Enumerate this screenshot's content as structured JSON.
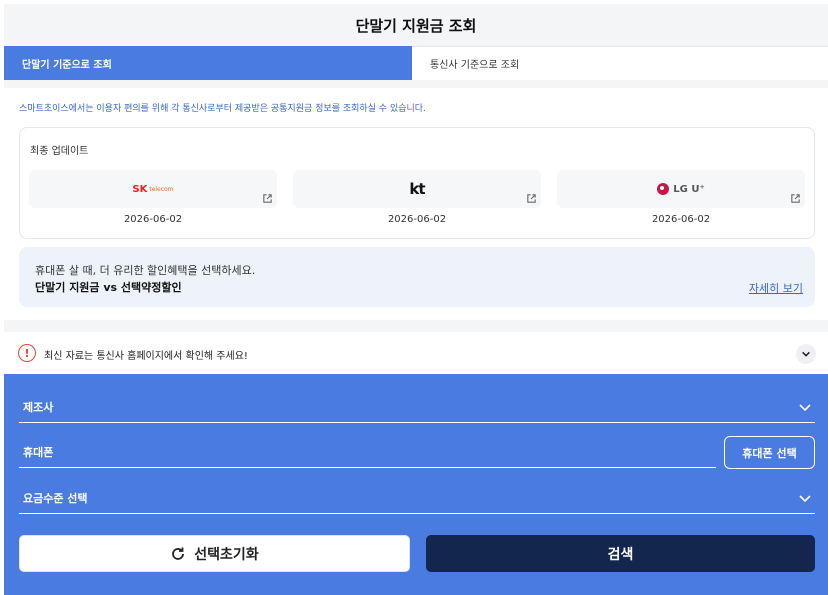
{
  "header": {
    "title": "단말기 지원금 조회"
  },
  "tabs": [
    {
      "label": "단말기 기준으로 조회",
      "active": true
    },
    {
      "label": "통신사 기준으로 조회",
      "active": false
    }
  ],
  "notice": "스마트초이스에서는 이용자 편의를 위해 각 통신사로부터 제공받은 공통지원금 정보를 조회하실 수 있습니다.",
  "update": {
    "title": "최종 업데이트",
    "carriers": [
      {
        "logo_main": "SK",
        "logo_sub": "telecom",
        "date": "2026-06-02"
      },
      {
        "logo_main": "kt",
        "date": "2026-06-02"
      },
      {
        "logo_main": "LG U⁺",
        "date": "2026-06-02"
      }
    ]
  },
  "promo": {
    "line1": "휴대폰 살 때, 더 유리한 할인혜택을 선택하세요.",
    "line2": "단말기 지원금 vs 선택약정할인",
    "link": "자세히 보기"
  },
  "alert": {
    "icon": "!",
    "text": "최신 자료는 통신사 홈페이지에서 확인해 주세요!"
  },
  "search": {
    "manufacturer_label": "제조사",
    "phone_label": "휴대폰",
    "phone_button": "휴대폰 선택",
    "plan_label": "요금수준 선택",
    "reset_label": "선택초기화",
    "search_label": "검색"
  },
  "colors": {
    "accent": "#4a7be1",
    "dark": "#13264d",
    "link": "#3a67c9",
    "alert": "#e0473a"
  }
}
